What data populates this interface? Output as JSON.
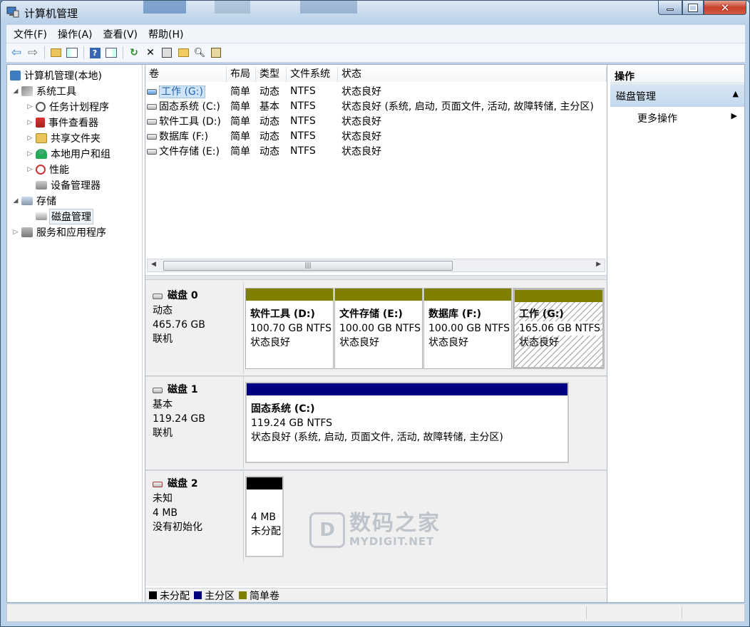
{
  "window": {
    "title": "计算机管理"
  },
  "menu": [
    "文件(F)",
    "操作(A)",
    "查看(V)",
    "帮助(H)"
  ],
  "tree": {
    "root": "计算机管理(本地)",
    "system_tools": "系统工具",
    "task_scheduler": "任务计划程序",
    "event_viewer": "事件查看器",
    "shared_folders": "共享文件夹",
    "local_users": "本地用户和组",
    "performance": "性能",
    "device_manager": "设备管理器",
    "storage": "存储",
    "disk_management": "磁盘管理",
    "services_apps": "服务和应用程序"
  },
  "volume_list": {
    "columns": [
      "卷",
      "布局",
      "类型",
      "文件系统",
      "状态"
    ],
    "rows": [
      {
        "name": "工作 (G:)",
        "layout": "简单",
        "type": "动态",
        "fs": "NTFS",
        "status": "状态良好"
      },
      {
        "name": "固态系统 (C:)",
        "layout": "简单",
        "type": "基本",
        "fs": "NTFS",
        "status": "状态良好 (系统, 启动, 页面文件, 活动, 故障转储, 主分区)"
      },
      {
        "name": "软件工具 (D:)",
        "layout": "简单",
        "type": "动态",
        "fs": "NTFS",
        "status": "状态良好"
      },
      {
        "name": "数据库 (F:)",
        "layout": "简单",
        "type": "动态",
        "fs": "NTFS",
        "status": "状态良好"
      },
      {
        "name": "文件存储 (E:)",
        "layout": "简单",
        "type": "动态",
        "fs": "NTFS",
        "status": "状态良好"
      }
    ]
  },
  "disks": {
    "disk0": {
      "name": "磁盘 0",
      "kind": "动态",
      "size": "465.76 GB",
      "state": "联机",
      "parts": [
        {
          "name": "软件工具 (D:)",
          "size": "100.70 GB NTFS",
          "status": "状态良好"
        },
        {
          "name": "文件存储 (E:)",
          "size": "100.00 GB NTFS",
          "status": "状态良好"
        },
        {
          "name": "数据库 (F:)",
          "size": "100.00 GB NTFS",
          "status": "状态良好"
        },
        {
          "name": "工作 (G:)",
          "size": "165.06 GB NTFS",
          "status": "状态良好"
        }
      ]
    },
    "disk1": {
      "name": "磁盘 1",
      "kind": "基本",
      "size": "119.24 GB",
      "state": "联机",
      "parts": [
        {
          "name": "固态系统 (C:)",
          "size": "119.24 GB NTFS",
          "status": "状态良好 (系统, 启动, 页面文件, 活动, 故障转储, 主分区)"
        }
      ]
    },
    "disk2": {
      "name": "磁盘 2",
      "kind": "未知",
      "size": "4 MB",
      "state": "没有初始化",
      "parts": [
        {
          "size": "4 MB",
          "status": "未分配"
        }
      ]
    }
  },
  "legend": [
    "未分配",
    "主分区",
    "简单卷"
  ],
  "colors": {
    "unallocated": "#000000",
    "primary": "#000080",
    "simple": "#808000"
  },
  "actions": {
    "title": "操作",
    "group": "磁盘管理",
    "more": "更多操作"
  },
  "watermark": {
    "cn": "数码之家",
    "en": "MYDIGIT.NET"
  }
}
